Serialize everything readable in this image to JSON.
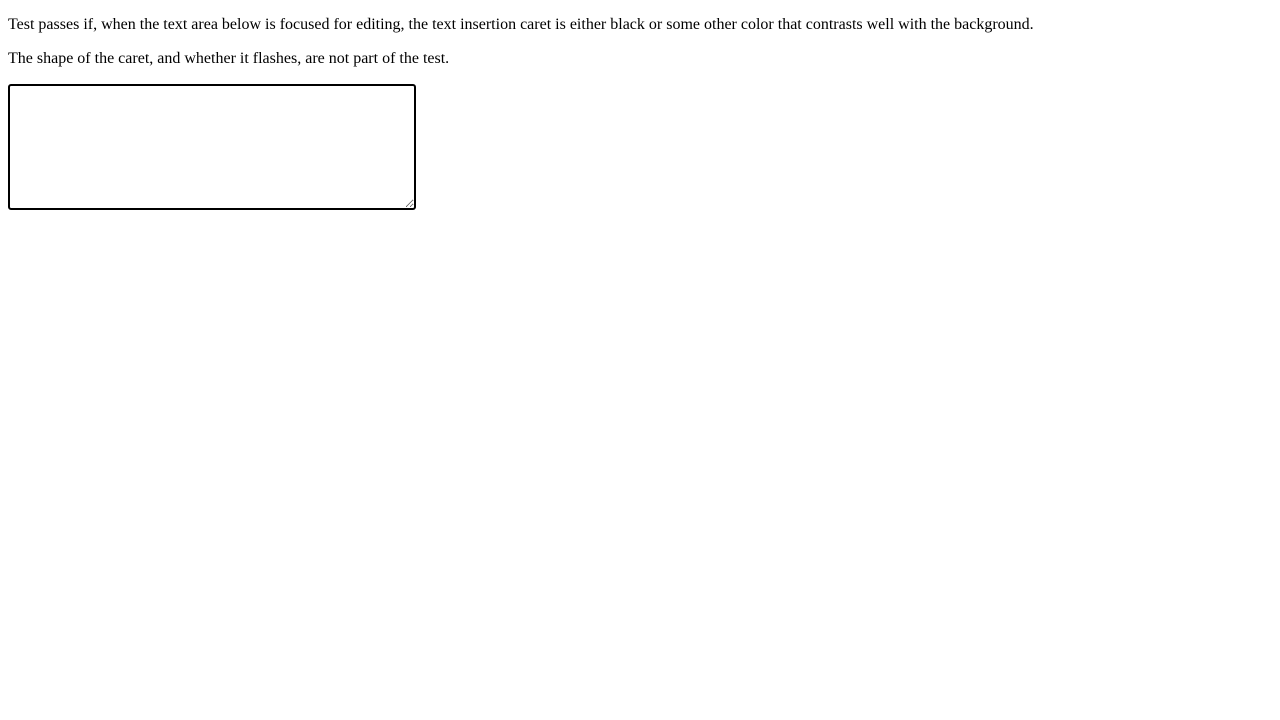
{
  "instructions": {
    "line1": "Test passes if, when the text area below is focused for editing, the text insertion caret is either black or some other color that contrasts well with the background.",
    "line2": "The shape of the caret, and whether it flashes, are not part of the test."
  },
  "textarea": {
    "value": "",
    "placeholder": ""
  },
  "colors": {
    "background": "#ffffff",
    "text": "#000000",
    "textarea_border": "#000000"
  }
}
